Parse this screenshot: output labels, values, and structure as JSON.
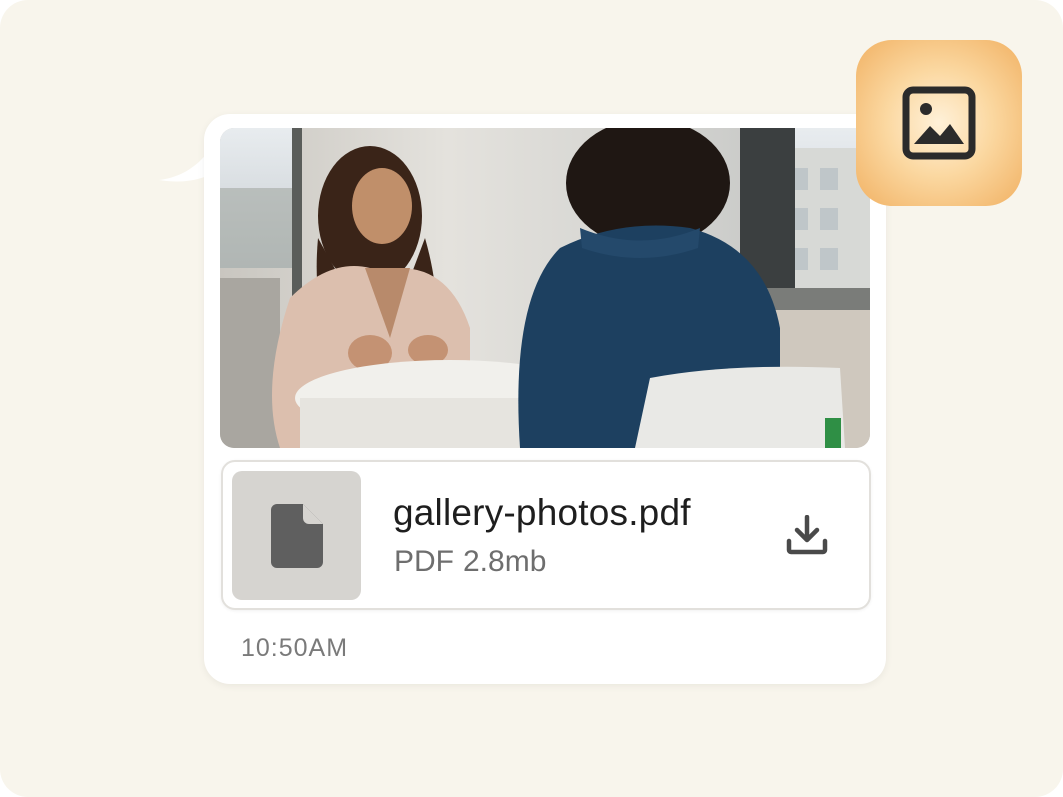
{
  "message": {
    "attachment_image": {
      "icon": "photo-image",
      "description": "two-people-meeting-photo"
    },
    "file": {
      "name": "gallery-photos.pdf",
      "type": "PDF",
      "size": "2.8mb",
      "icon": "document-icon",
      "download_icon": "download-icon"
    },
    "timestamp": "10:50AM"
  },
  "badge": {
    "icon": "image-icon",
    "accent_color": "#f4b765"
  },
  "colors": {
    "background": "#f8f5ec",
    "bubble": "#ffffff",
    "file_thumb": "#d6d4d0",
    "icon_dark": "#2b2b2b"
  }
}
